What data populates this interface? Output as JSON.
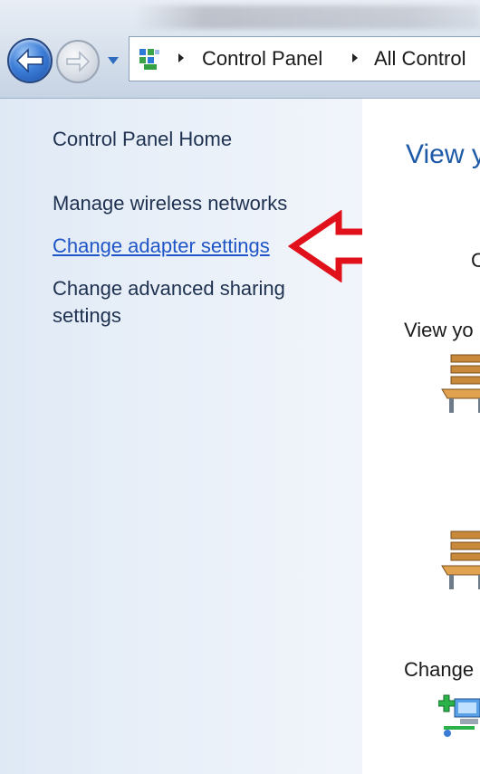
{
  "address_bar": {
    "breadcrumbs": [
      "Control Panel",
      "All Control"
    ]
  },
  "left_pane": {
    "links": [
      "Control Panel Home",
      "Manage wireless networks",
      "Change adapter settings",
      "Change advanced sharing",
      "settings"
    ]
  },
  "content": {
    "heading": "View y",
    "stub_letter": "C",
    "section1": "View yo",
    "section2": "Change"
  },
  "colors": {
    "link_active": "#1f55c7",
    "annotation_arrow": "#e0111a",
    "heading": "#1e5aa8"
  },
  "icons": [
    "back-arrow-icon",
    "forward-arrow-icon",
    "history-dropdown-icon",
    "control-panel-icon",
    "breadcrumb-separator-icon",
    "network-bench-icon",
    "network-setup-icon"
  ]
}
